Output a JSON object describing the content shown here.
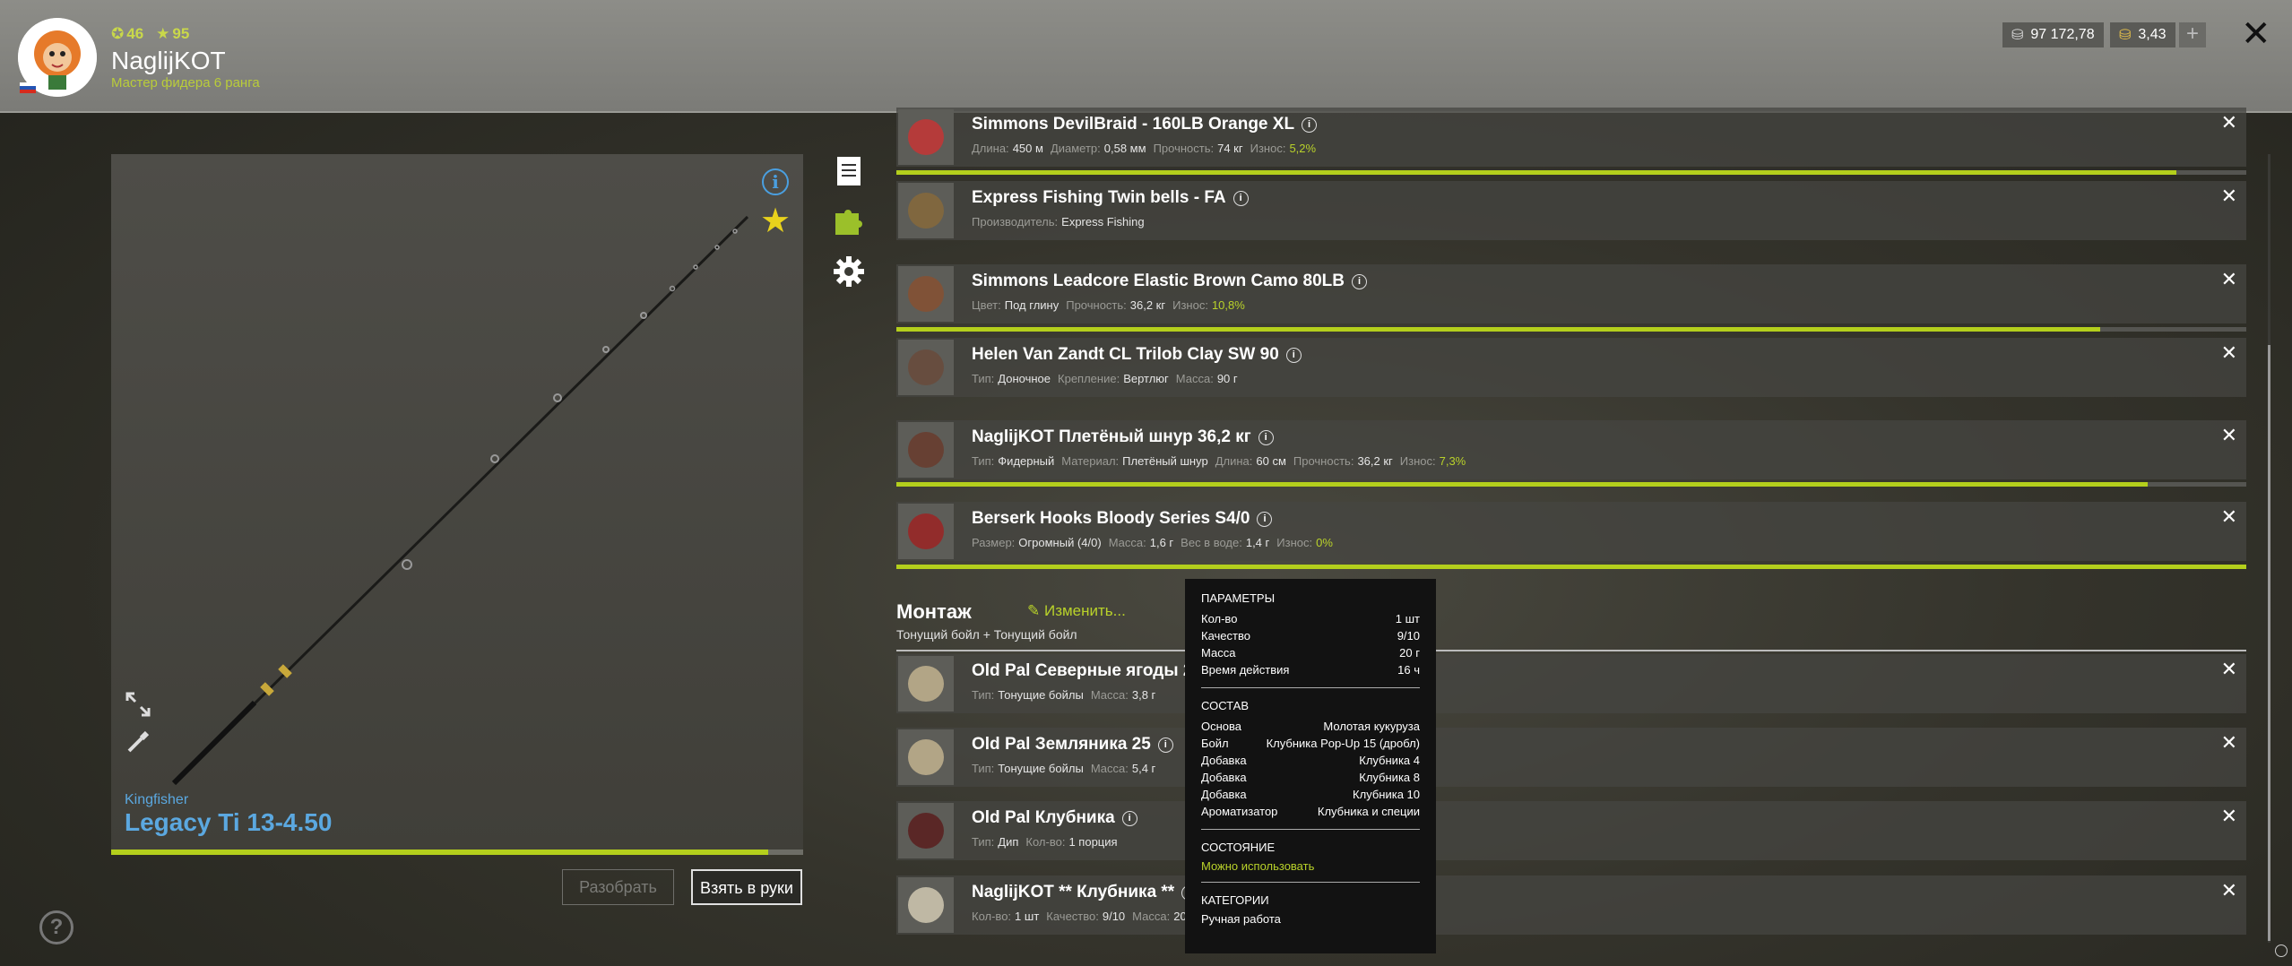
{
  "header": {
    "stat_a": "46",
    "stat_b": "95",
    "username": "NaglijKOT",
    "rank": "Мастер фидера 6 ранга",
    "silver": "97 172,78",
    "gold": "3,43",
    "plus": "+"
  },
  "rod": {
    "brand": "Kingfisher",
    "name": "Legacy Ti 13-4.50",
    "wear_fraction": 0.95,
    "disassemble_label": "Разобрать",
    "take_label": "Взять в руки"
  },
  "items": [
    {
      "title": "Simmons DevilBraid - 160LB Orange XL",
      "props": [
        [
          "Длина:",
          "450 м"
        ],
        [
          "Диаметр:",
          "0,58 мм"
        ],
        [
          "Прочность:",
          "74 кг"
        ],
        [
          "Износ:",
          "5,2%"
        ]
      ],
      "wear_fraction": 0.948
    },
    {
      "title": "Express Fishing Twin bells - FA",
      "props": [
        [
          "Производитель:",
          "Express Fishing"
        ]
      ]
    },
    {
      "title": "Simmons Leadcore Elastic Brown Camo 80LB",
      "props": [
        [
          "Цвет:",
          "Под глину"
        ],
        [
          "Прочность:",
          "36,2 кг"
        ],
        [
          "Износ:",
          "10,8%"
        ]
      ],
      "wear_fraction": 0.892
    },
    {
      "title": "Helen Van Zandt CL Trilob Clay SW 90",
      "props": [
        [
          "Тип:",
          "Доночное"
        ],
        [
          "Крепление:",
          "Вертлюг"
        ],
        [
          "Масса:",
          "90 г"
        ]
      ]
    },
    {
      "title": "NaglijKOT Плетёный шнур 36,2 кг",
      "props": [
        [
          "Тип:",
          "Фидерный"
        ],
        [
          "Материал:",
          "Плетёный шнур"
        ],
        [
          "Длина:",
          "60 см"
        ],
        [
          "Прочность:",
          "36,2 кг"
        ],
        [
          "Износ:",
          "7,3%"
        ]
      ],
      "wear_fraction": 0.927
    },
    {
      "title": "Berserk Hooks Bloody Series S4/0",
      "props": [
        [
          "Размер:",
          "Огромный (4/0)"
        ],
        [
          "Масса:",
          "1,6 г"
        ],
        [
          "Вес в воде:",
          "1,4 г"
        ],
        [
          "Износ:",
          "0%"
        ]
      ],
      "wear_fraction": 1.0
    }
  ],
  "montage": {
    "title": "Монтаж",
    "edit_label": "Изменить...",
    "subtitle": "Тонущий бойл  +  Тонущий бойл"
  },
  "baits": [
    {
      "title": "Old Pal Северные ягоды 20",
      "props": [
        [
          "Тип:",
          "Тонущие бойлы"
        ],
        [
          "Масса:",
          "3,8 г"
        ]
      ]
    },
    {
      "title": "Old Pal Земляника 25",
      "props": [
        [
          "Тип:",
          "Тонущие бойлы"
        ],
        [
          "Масса:",
          "5,4 г"
        ]
      ]
    },
    {
      "title": "Old Pal Клубника",
      "props": [
        [
          "Тип:",
          "Дип"
        ],
        [
          "Кол-во:",
          "1 порция"
        ]
      ]
    },
    {
      "title": "NaglijKOT ** Клубника **",
      "props": [
        [
          "Кол-во:",
          "1 шт"
        ],
        [
          "Качество:",
          "9/10"
        ],
        [
          "Масса:",
          "20 г"
        ]
      ]
    }
  ],
  "tooltip": {
    "params_header": "ПАРАМЕТРЫ",
    "params": [
      [
        "Кол-во",
        "1 шт"
      ],
      [
        "Качество",
        "9/10"
      ],
      [
        "Масса",
        "20 г"
      ],
      [
        "Время действия",
        "16 ч"
      ]
    ],
    "composition_header": "СОСТАВ",
    "composition": [
      [
        "Основа",
        "Молотая кукуруза"
      ],
      [
        "Бойл",
        "Клубника Pop-Up 15 (дробл)"
      ],
      [
        "Добавка",
        "Клубника 4"
      ],
      [
        "Добавка",
        "Клубника 8"
      ],
      [
        "Добавка",
        "Клубника 10"
      ],
      [
        "Ароматизатор",
        "Клубника и специи"
      ]
    ],
    "state_header": "СОСТОЯНИЕ",
    "state_value": "Можно использовать",
    "categories_header": "КАТЕГОРИИ",
    "categories_value": "Ручная работа"
  },
  "colors": {
    "accent_green": "#b4cf1c",
    "rod_blue": "#5ba8e0",
    "star_yellow": "#e8d21c"
  },
  "icons": [
    "expand-icon",
    "brush-icon",
    "info-icon",
    "star-icon",
    "notes-icon",
    "puzzle-icon",
    "gear-icon",
    "help-icon",
    "close-icon"
  ]
}
